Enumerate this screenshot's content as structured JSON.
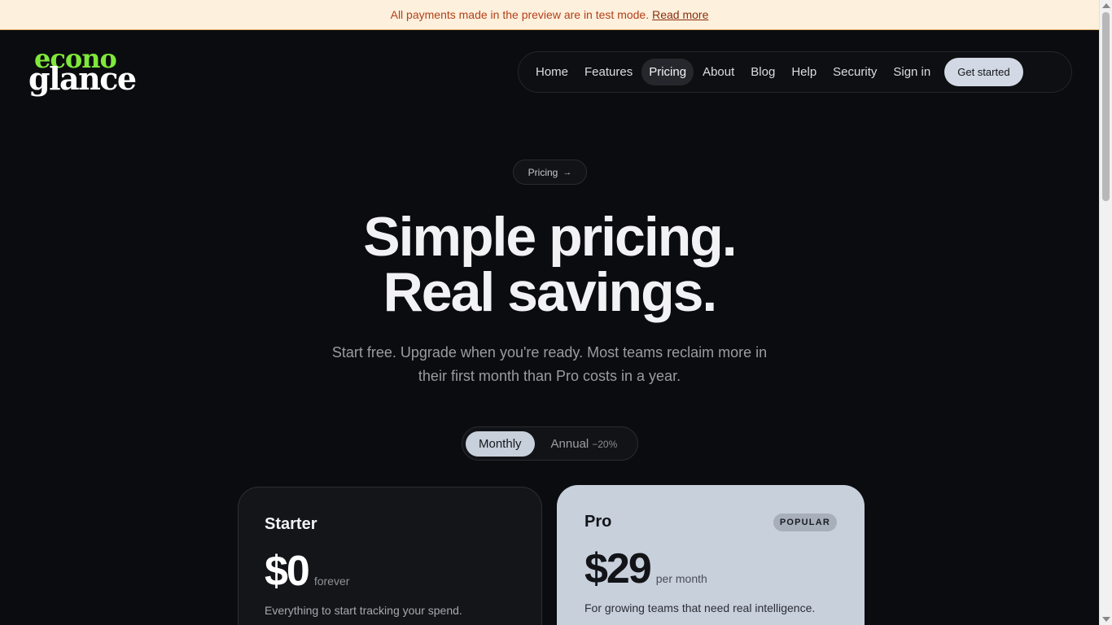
{
  "banner": {
    "text": "All payments made in the preview are in test mode.",
    "link": "Read more"
  },
  "logo": {
    "line1": "econo",
    "line2": "glance",
    "accent_color": "#7fe83a"
  },
  "nav": {
    "items": [
      {
        "label": "Home"
      },
      {
        "label": "Features"
      },
      {
        "label": "Pricing",
        "active": true
      },
      {
        "label": "About"
      },
      {
        "label": "Blog"
      },
      {
        "label": "Help"
      },
      {
        "label": "Security"
      },
      {
        "label": "Sign in"
      }
    ],
    "cta": "Get started"
  },
  "eyebrow": {
    "label": "Pricing",
    "icon": "arrow-right-icon"
  },
  "hero": {
    "line1": "Simple pricing.",
    "line2": "Real savings.",
    "subtitle_line1": "Start free. Upgrade when you're ready. Most teams reclaim more in",
    "subtitle_line2": "their first month than Pro costs in a year."
  },
  "billing_toggle": {
    "options": [
      {
        "label": "Monthly",
        "selected": true
      },
      {
        "label": "Annual",
        "discount": "−20%",
        "selected": false
      }
    ]
  },
  "plans": [
    {
      "name": "Starter",
      "price": "$0",
      "period": "forever",
      "description": "Everything to start tracking your spend."
    },
    {
      "name": "Pro",
      "badge": "POPULAR",
      "price": "$29",
      "period": "per month",
      "description": "For growing teams that need real intelligence."
    }
  ],
  "colors": {
    "background": "#0b0c0f",
    "banner_bg": "#fdf0dc",
    "banner_text": "#b3401a",
    "pro_card": "#c8d0dc"
  }
}
